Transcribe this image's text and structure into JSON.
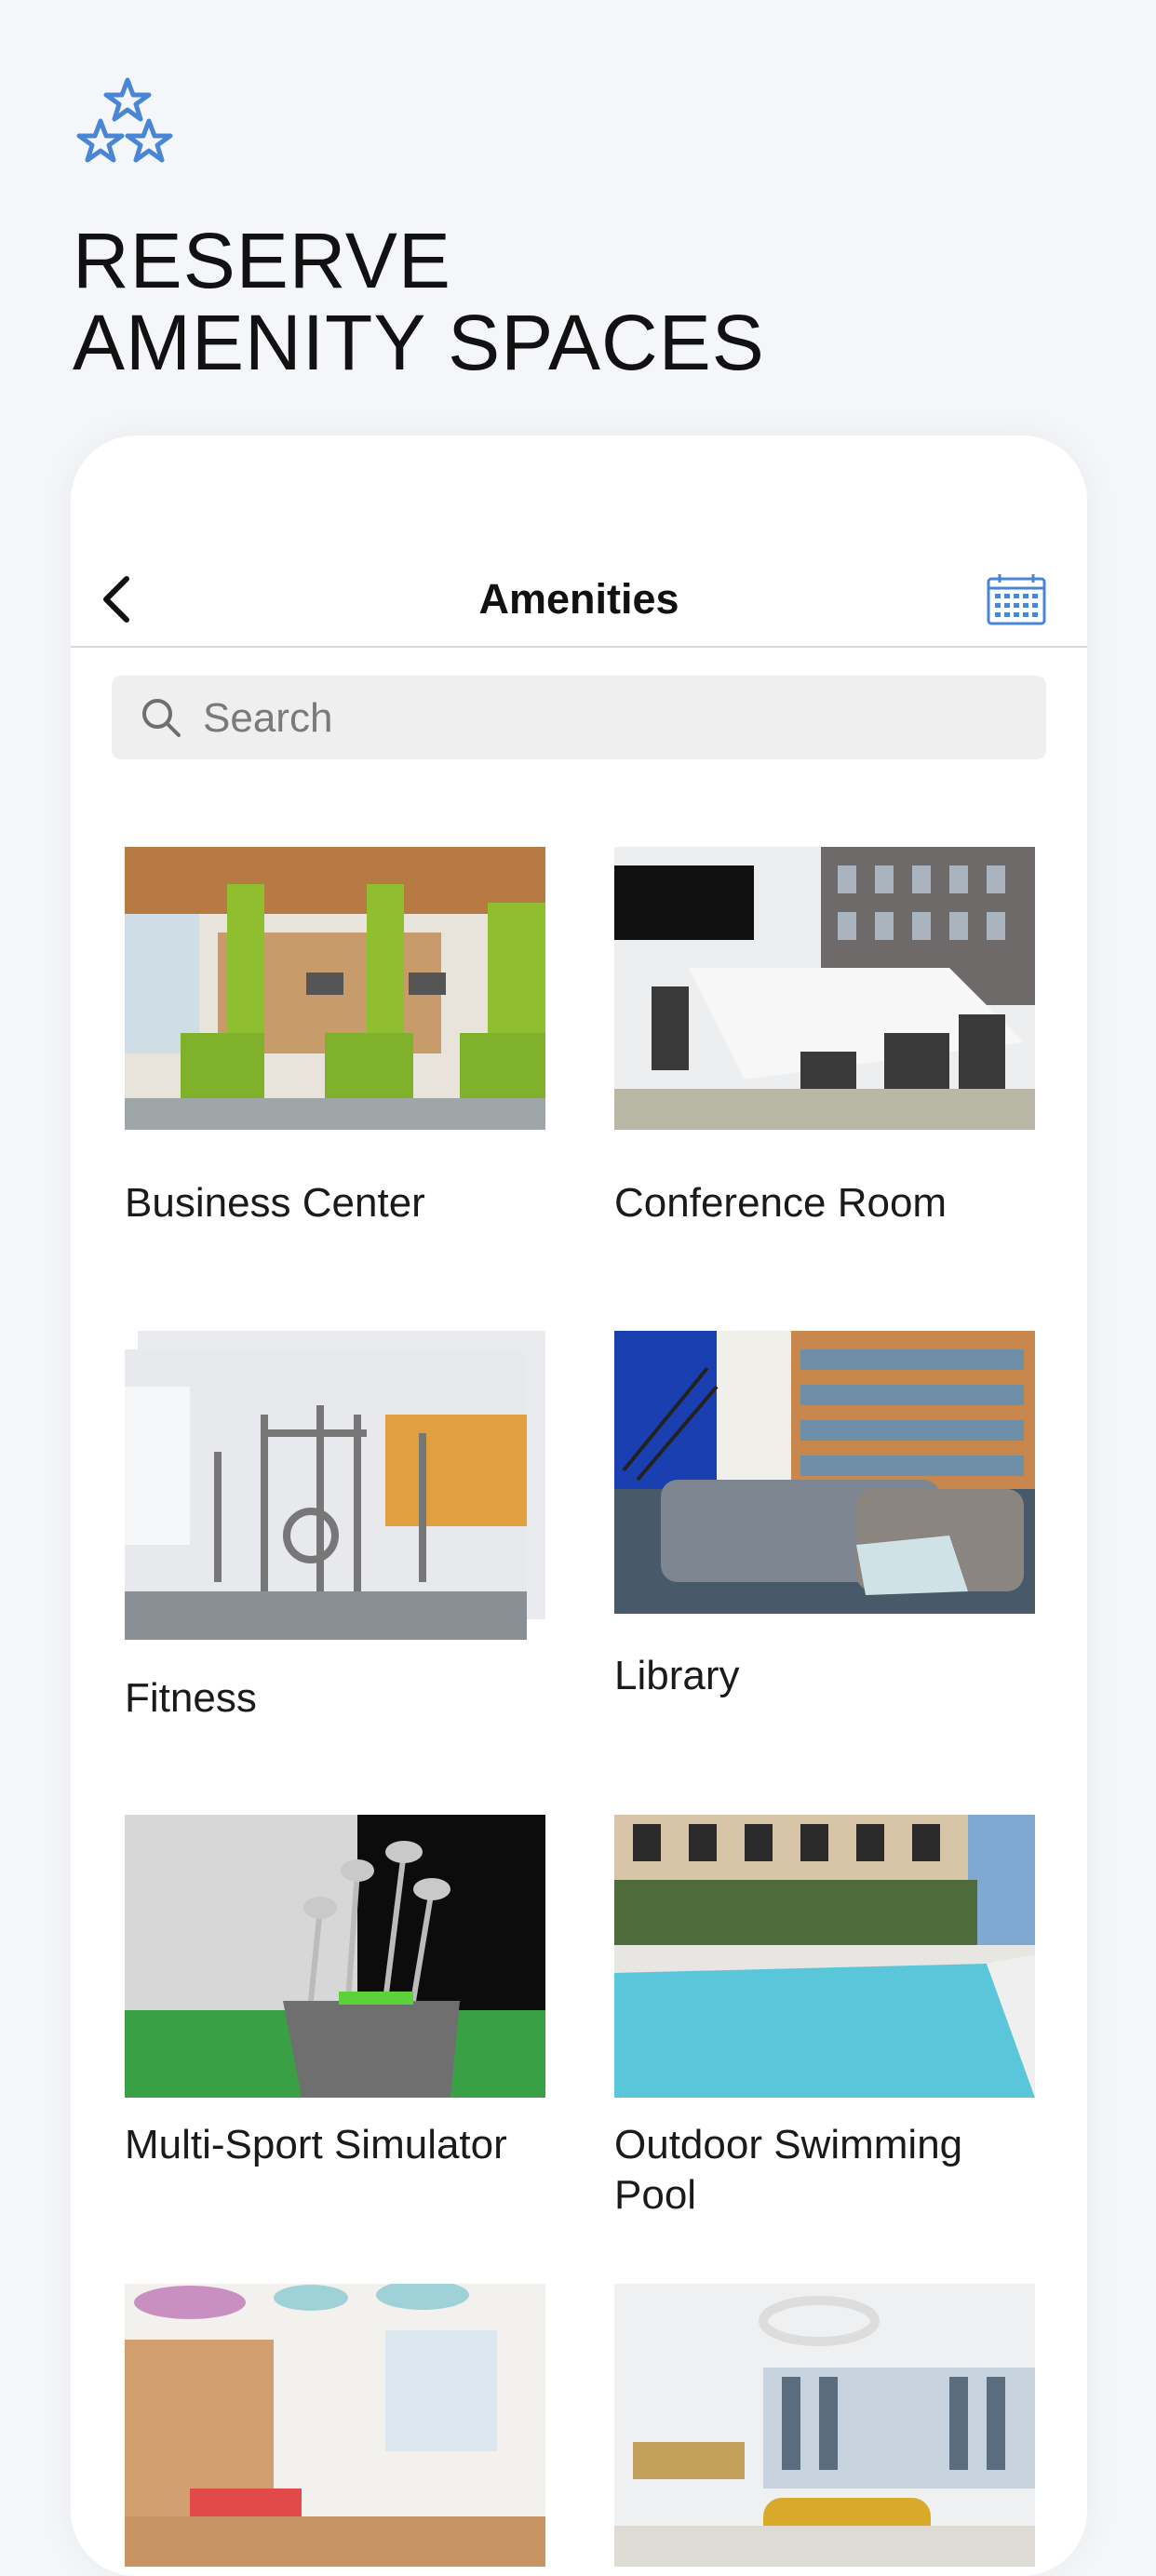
{
  "page": {
    "headline_line1": "RESERVE",
    "headline_line2": "AMENITY SPACES",
    "logo_icon": "three-stars-icon",
    "accent_color": "#4a86d6"
  },
  "navbar": {
    "title": "Amenities",
    "back_icon": "chevron-left-icon",
    "calendar_icon": "calendar-icon"
  },
  "search": {
    "placeholder": "Search",
    "value": ""
  },
  "amenities": [
    {
      "name": "Business Center"
    },
    {
      "name": "Conference Room"
    },
    {
      "name": "Fitness"
    },
    {
      "name": "Library"
    },
    {
      "name": "Multi-Sport Simulator"
    },
    {
      "name": "Outdoor Swimming Pool"
    },
    {
      "name": ""
    },
    {
      "name": ""
    }
  ]
}
